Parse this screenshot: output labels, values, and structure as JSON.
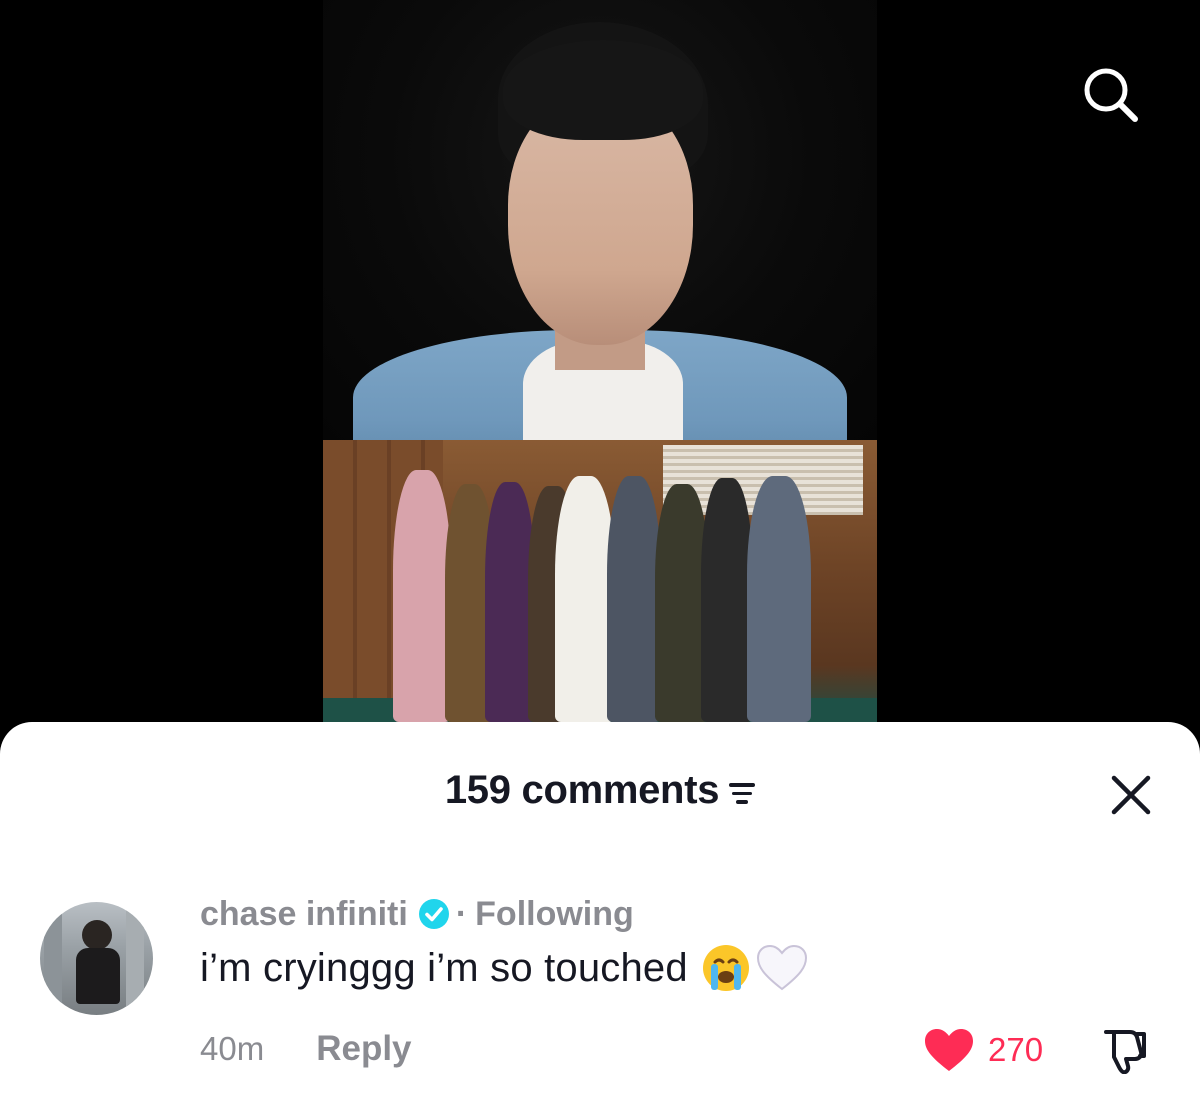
{
  "header": {
    "comment_count": "159 comments"
  },
  "icons": {
    "search": "search-icon",
    "sort": "sort-icon",
    "close": "close-icon",
    "verified": "verified-badge-icon",
    "like": "heart-icon",
    "dislike": "thumbs-down-icon"
  },
  "comment": {
    "username": "chase infiniti",
    "separator": "·",
    "follow_status": "Following",
    "text": "i’m cryinggg i’m so touched",
    "time": "40m",
    "reply_label": "Reply",
    "like_count": "270"
  },
  "colors": {
    "like_red": "#fe2c55",
    "verified_blue": "#20d5ec",
    "text_primary": "#161823",
    "text_secondary": "#8a8b91"
  }
}
